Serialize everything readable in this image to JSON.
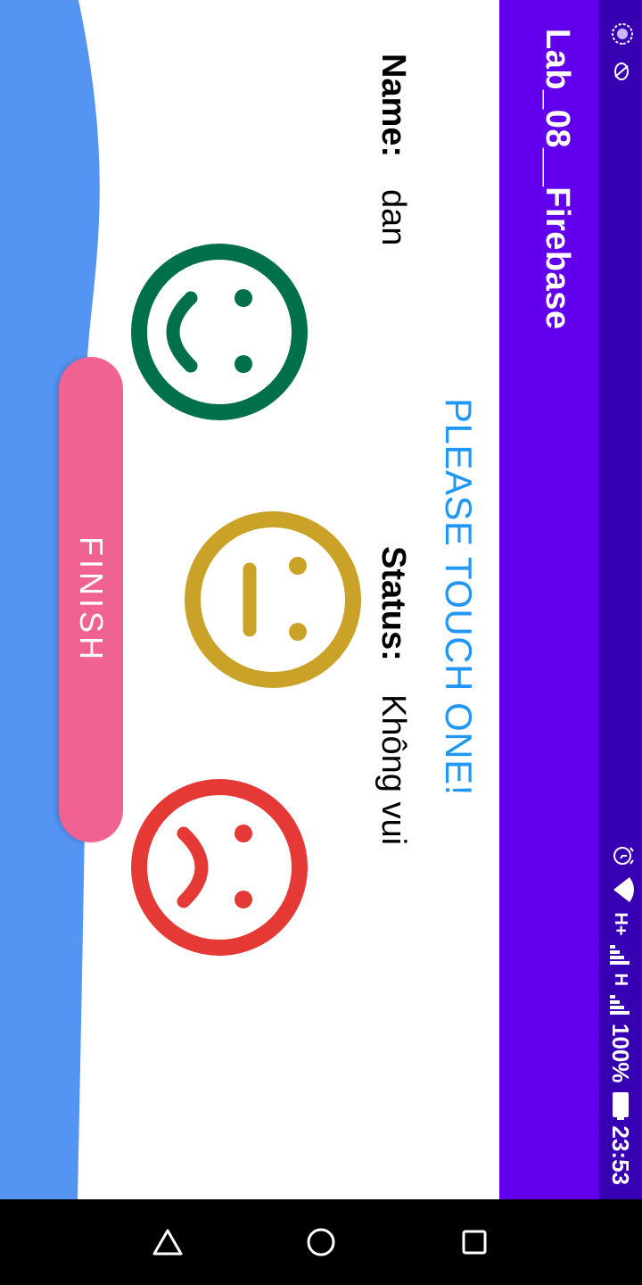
{
  "status_bar": {
    "network_1": "H+",
    "network_2": "H",
    "battery": "100%",
    "time": "23:53"
  },
  "app_bar": {
    "title": "Lab_08__Firebase"
  },
  "main": {
    "name_label": "Name:",
    "name_value": "dan",
    "prompt": "PLEASE TOUCH ONE!",
    "status_label": "Status:",
    "status_value": "Không vui",
    "faces": [
      {
        "mood": "happy",
        "color": "#00704a"
      },
      {
        "mood": "neutral",
        "color": "#c9a227"
      },
      {
        "mood": "sad",
        "color": "#e53935"
      }
    ],
    "finish_label": "FINISH"
  },
  "colors": {
    "status_bar": "#3700b3",
    "app_bar": "#6200ee",
    "prompt": "#2196f3",
    "finish_button": "#f06292",
    "background_wave": "#5494f3"
  },
  "nav_bar": {
    "icons": [
      "back-icon",
      "home-icon",
      "recents-icon"
    ]
  }
}
